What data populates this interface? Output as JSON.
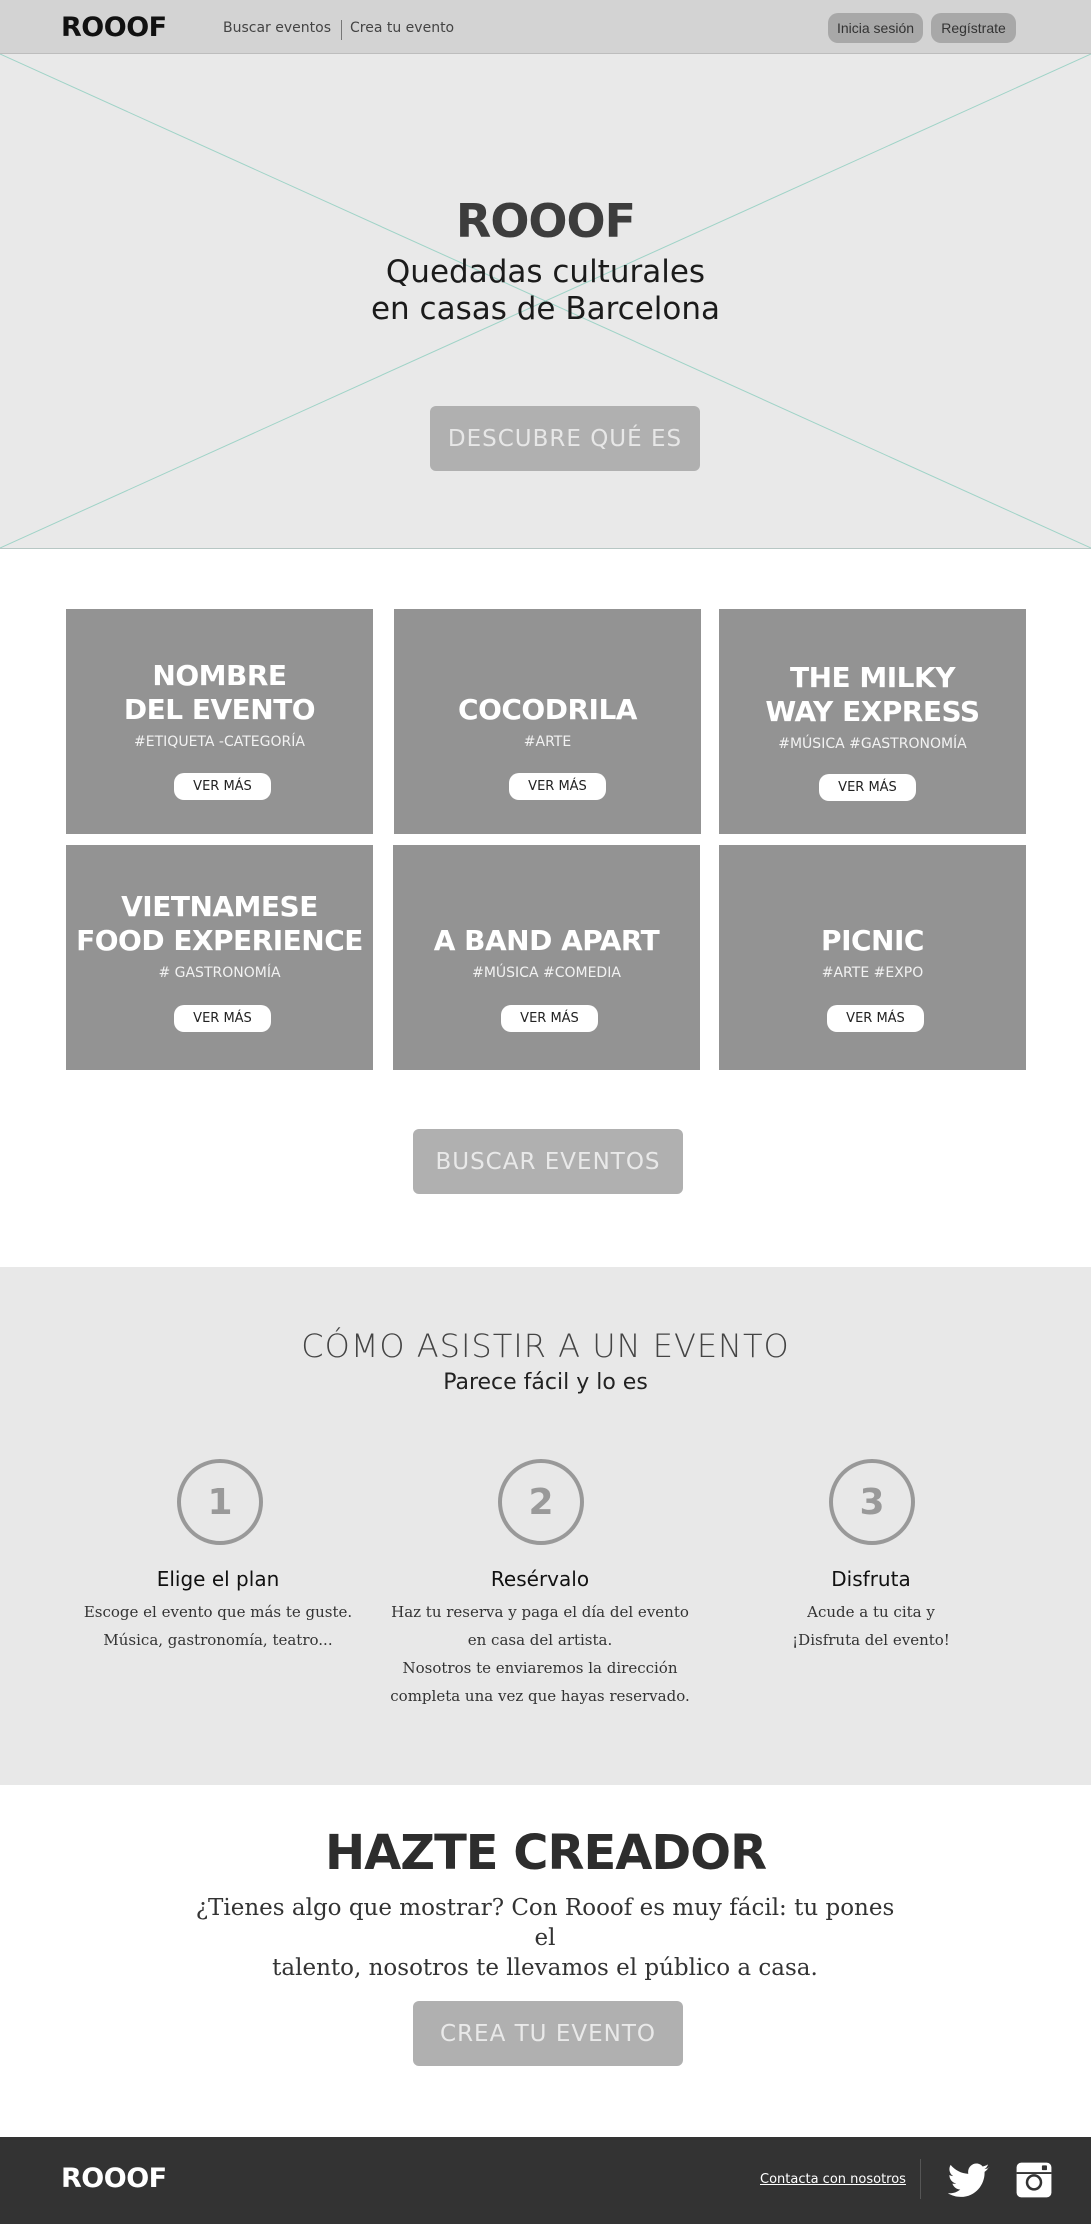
{
  "nav": {
    "logo": "ROOOF",
    "links": [
      "Buscar eventos",
      "Crea tu evento"
    ],
    "login": "Inicia sesión",
    "register": "Regístrate"
  },
  "hero": {
    "title": "ROOOF",
    "subtitle_line1": "Quedadas culturales",
    "subtitle_line2": "en casas de Barcelona",
    "cta": "DESCUBRE QUÉ ES"
  },
  "events": [
    {
      "name_line1": "NOMBRE",
      "name_line2": "DEL EVENTO",
      "tags": "#ETIQUETA -CATEGORÍA",
      "button": "VER MÁS"
    },
    {
      "name_line1": "",
      "name_line2": "COCODRILA",
      "tags": "#ARTE",
      "button": "VER MÁS"
    },
    {
      "name_line1": "THE MILKY",
      "name_line2": "WAY EXPRESS",
      "tags": "#MÚSICA  #GASTRONOMÍA",
      "button": "VER MÁS"
    },
    {
      "name_line1": "VIETNAMESE",
      "name_line2": "FOOD EXPERIENCE",
      "tags": "# GASTRONOMÍA",
      "button": "VER MÁS"
    },
    {
      "name_line1": "",
      "name_line2": "A BAND APART",
      "tags": "#MÚSICA #COMEDIA",
      "button": "VER MÁS"
    },
    {
      "name_line1": "",
      "name_line2": "PICNIC",
      "tags": "#ARTE  #EXPO",
      "button": "VER MÁS"
    }
  ],
  "search_button": "BUSCAR EVENTOS",
  "howto": {
    "title": "CÓMO ASISTIR A UN EVENTO",
    "subtitle": "Parece fácil y lo es",
    "steps": [
      {
        "number": "1",
        "title": "Elige el plan",
        "lines": [
          "Escoge el evento que más te guste.",
          "Música, gastronomía, teatro..."
        ]
      },
      {
        "number": "2",
        "title": "Resérvalo",
        "lines": [
          "Haz tu reserva y paga el día del evento",
          "en casa del artista.",
          "Nosotros te enviaremos la dirección",
          "completa una vez que hayas reservado."
        ]
      },
      {
        "number": "3",
        "title": "Disfruta",
        "lines": [
          "Acude a tu cita y",
          "¡Disfruta del evento!"
        ]
      }
    ]
  },
  "creator": {
    "title": "HAZTE CREADOR",
    "text_line1": "¿Tienes algo que mostrar? Con Rooof es muy fácil: tu pones  el",
    "text_line2": "talento, nosotros te llevamos el público a casa.",
    "button": "CREA TU EVENTO"
  },
  "footer": {
    "logo": "ROOOF",
    "contact": "Contacta con nosotros",
    "social_icons": [
      "twitter-icon",
      "instagram-icon"
    ]
  },
  "colors": {
    "nav_bg": "#d3d3d3",
    "hero_bg": "#e9e9e9",
    "card_bg": "#939393",
    "button_bg": "#b0b0b0",
    "section_bg": "#e8e8e8",
    "footer_bg": "#333333"
  }
}
